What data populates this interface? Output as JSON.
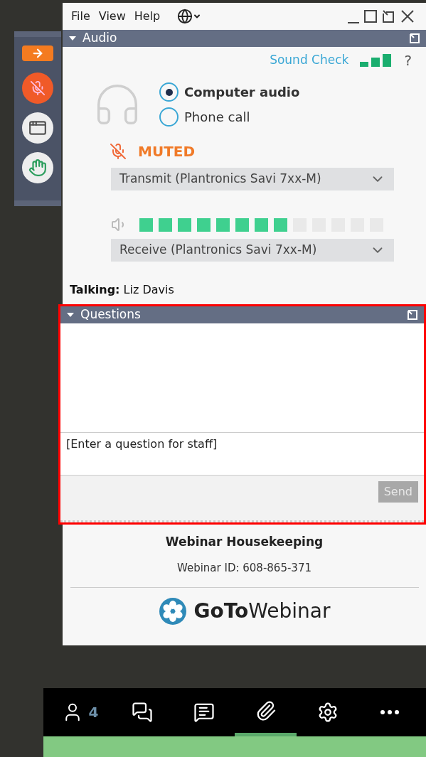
{
  "menu": [
    "File",
    "View",
    "Help"
  ],
  "audio": {
    "title": "Audio",
    "sound_check": "Sound Check",
    "help": "?",
    "options": [
      {
        "label": "Computer audio",
        "selected": true
      },
      {
        "label": "Phone call",
        "selected": false
      }
    ],
    "status": "MUTED",
    "transmit": "Transmit (Plantronics Savi 7xx-M)",
    "level": 0.615,
    "receive": "Receive (Plantronics Savi 7xx-M)",
    "talking": "**Talking:** Liz Davis"
  },
  "questions": {
    "title": "Questions",
    "placeholder": "[Enter a question for staff]",
    "send": {
      "label": "Send",
      "disabled": true
    }
  },
  "footer": {
    "title": "Webinar Housekeeping",
    "webinar_id": "Webinar ID: 608-865-371",
    "logo": "**GoTo**Webinar"
  },
  "bottom_bar": [
    {
      "kind": "people",
      "count": "4",
      "selected": false
    },
    {
      "kind": "chat",
      "selected": false
    },
    {
      "kind": "question",
      "selected": false
    },
    {
      "kind": "handouts",
      "selected": true
    },
    {
      "kind": "settings",
      "selected": false
    },
    {
      "kind": "more",
      "selected": false
    }
  ]
}
